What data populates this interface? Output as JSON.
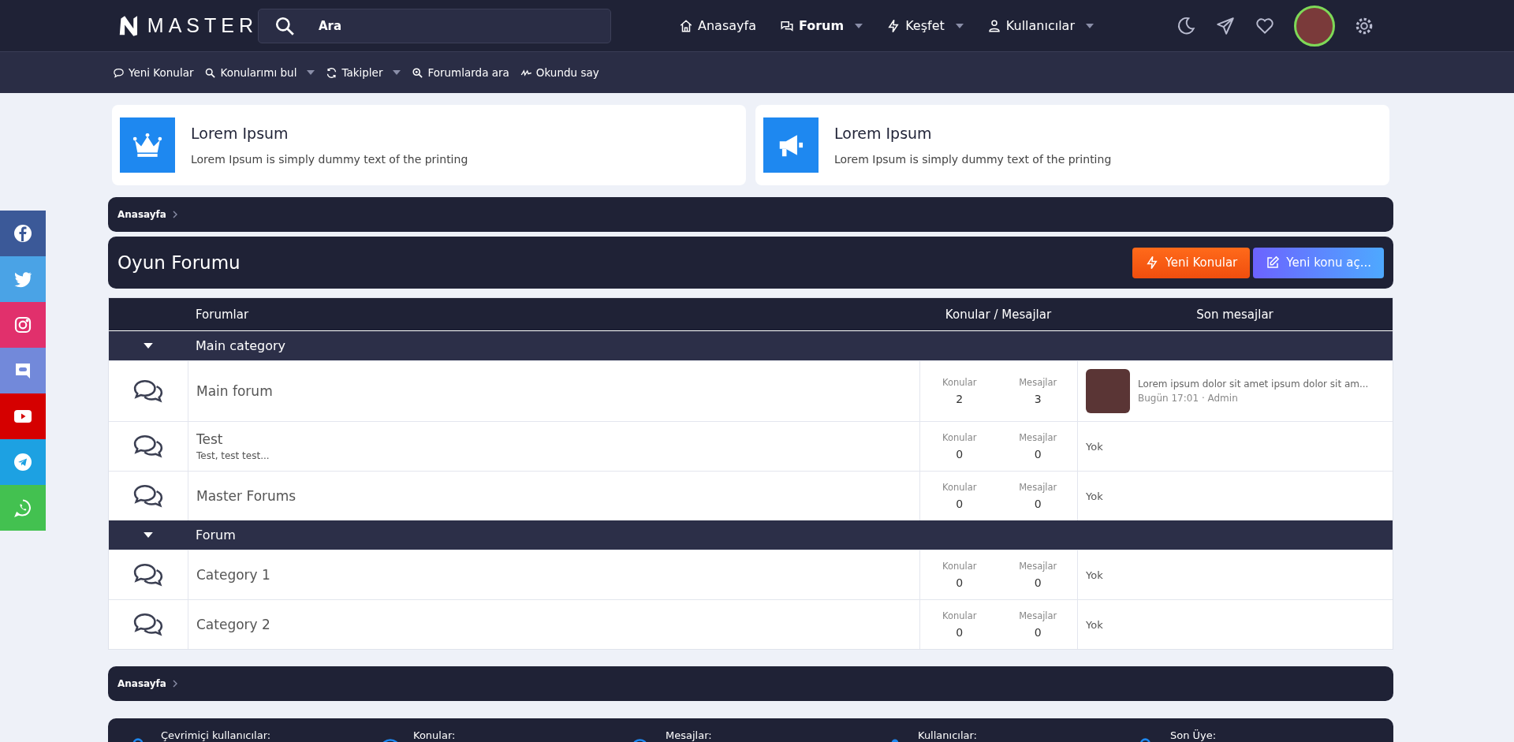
{
  "header": {
    "logo": "MASTER",
    "search": {
      "placeholder": "Ara"
    },
    "nav": [
      {
        "label": "Anasayfa",
        "selected": false,
        "dropdown": false
      },
      {
        "label": "Forum",
        "selected": true,
        "dropdown": true
      },
      {
        "label": "Keşfet",
        "selected": false,
        "dropdown": true
      },
      {
        "label": "Kullanıcılar",
        "selected": false,
        "dropdown": true
      }
    ]
  },
  "subnav": [
    {
      "label": "Yeni Konular",
      "dropdown": false
    },
    {
      "label": "Konularımı bul",
      "dropdown": true
    },
    {
      "label": "Takipler",
      "dropdown": true
    },
    {
      "label": "Forumlarda ara",
      "dropdown": false
    },
    {
      "label": "Okundu say",
      "dropdown": false
    }
  ],
  "cards": [
    {
      "title": "Lorem Ipsum",
      "text": "Lorem Ipsum is simply dummy text of the printing"
    },
    {
      "title": "Lorem Ipsum",
      "text": "Lorem Ipsum is simply dummy text of the printing"
    }
  ],
  "breadcrumb": [
    "Anasayfa"
  ],
  "page_title": "Oyun Forumu",
  "buttons": [
    {
      "label": "Yeni Konular",
      "kind": "hot"
    },
    {
      "label": "Yeni konu aç...",
      "kind": "create"
    }
  ],
  "table": {
    "columns": [
      "Forumlar",
      "Konular / Mesajlar",
      "Son mesajlar"
    ],
    "categories": [
      {
        "title": "Main category",
        "expanded": true,
        "forums": [
          {
            "name": "Main forum",
            "topics_label": "Konular",
            "topics": "2",
            "messages_label": "Mesajlar",
            "messages": "3",
            "last": {
              "kind": "post",
              "title": "Lorem ipsum dolor sit amet ipsum dolor sit am...",
              "meta": "Bugün 17:01 · Admin"
            }
          },
          {
            "name": "Test",
            "description": "Test, test test...",
            "topics_label": "Konular",
            "topics": "0",
            "messages_label": "Mesajlar",
            "messages": "0",
            "last": {
              "kind": "none",
              "text": "Yok"
            }
          },
          {
            "name": "Master Forums",
            "topics_label": "Konular",
            "topics": "0",
            "messages_label": "Mesajlar",
            "messages": "0",
            "last": {
              "kind": "none",
              "text": "Yok"
            }
          }
        ]
      },
      {
        "title": "Forum",
        "expanded": true,
        "forums": [
          {
            "name": "Category 1",
            "topics_label": "Konular",
            "topics": "0",
            "messages_label": "Mesajlar",
            "messages": "0",
            "last": {
              "kind": "none",
              "text": "Yok"
            }
          },
          {
            "name": "Category 2",
            "topics_label": "Konular",
            "topics": "0",
            "messages_label": "Mesajlar",
            "messages": "0",
            "last": {
              "kind": "none",
              "text": "Yok"
            }
          }
        ]
      }
    ]
  },
  "footer_breadcrumb": [
    "Anasayfa"
  ],
  "stats": [
    "Çevrimiçi kullanıcılar:",
    "Konular:",
    "Mesajlar:",
    "Kullanıcılar:",
    "Son Üye:"
  ],
  "social": [
    {
      "color": "#3b5998"
    },
    {
      "color": "#4aa3e6"
    },
    {
      "color": "#e1306c"
    },
    {
      "color": "#7289da"
    },
    {
      "color": "#d50000"
    },
    {
      "color": "#1da1e2"
    },
    {
      "color": "#43c150"
    }
  ]
}
